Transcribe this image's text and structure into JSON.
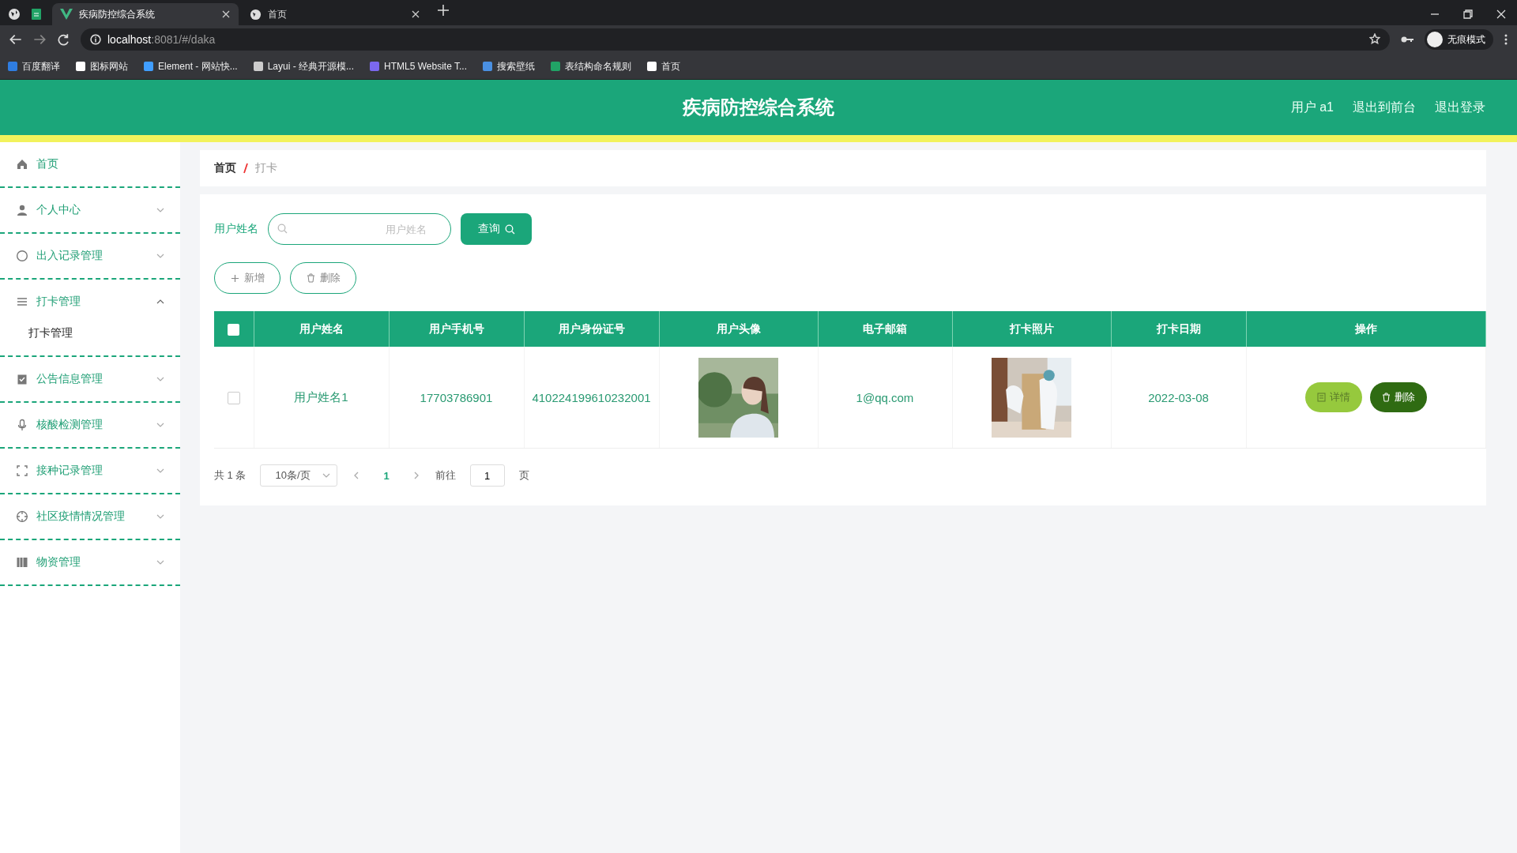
{
  "browser": {
    "tabs": [
      {
        "title": "疾病防控综合系统",
        "selected": true
      },
      {
        "title": "首页",
        "selected": false
      }
    ],
    "url_host": "localhost",
    "url_rest": ":8081/#/daka",
    "bookmarks": [
      {
        "label": "百度翻译",
        "color": "#2f7de1"
      },
      {
        "label": "图标网站",
        "color": "#ffffff"
      },
      {
        "label": "Element - 网站快...",
        "color": "#409eff"
      },
      {
        "label": "Layui - 经典开源模...",
        "color": "#cccccc"
      },
      {
        "label": "HTML5 Website T...",
        "color": "#7b68ee"
      },
      {
        "label": "搜索壁纸",
        "color": "#4a90e2"
      },
      {
        "label": "表结构命名规则",
        "color": "#21a366"
      },
      {
        "label": "首页",
        "color": "#ffffff"
      }
    ],
    "profile": "无痕模式"
  },
  "header": {
    "title": "疾病防控综合系统",
    "links": [
      "用户 a1",
      "退出到前台",
      "退出登录"
    ]
  },
  "sidebar": {
    "items": [
      {
        "kind": "home",
        "label": "首页"
      },
      {
        "kind": "user",
        "label": "个人中心",
        "expanded": false
      },
      {
        "kind": "compass",
        "label": "出入记录管理",
        "expanded": false
      },
      {
        "kind": "list",
        "label": "打卡管理",
        "expanded": true,
        "children": [
          {
            "label": "打卡管理"
          }
        ]
      },
      {
        "kind": "clipboard",
        "label": "公告信息管理",
        "expanded": false
      },
      {
        "kind": "mic",
        "label": "核酸检测管理",
        "expanded": false
      },
      {
        "kind": "frame",
        "label": "接种记录管理",
        "expanded": false
      },
      {
        "kind": "target",
        "label": "社区疫情情况管理",
        "expanded": false
      },
      {
        "kind": "books",
        "label": "物资管理",
        "expanded": false
      }
    ]
  },
  "breadcrumb": [
    "首页",
    "打卡"
  ],
  "search": {
    "label": "用户姓名",
    "placeholder": "用户姓名",
    "button": "查询"
  },
  "actions": [
    "新增",
    "删除"
  ],
  "table": {
    "header_checked": false,
    "columns": [
      "用户姓名",
      "用户手机号",
      "用户身份证号",
      "用户头像",
      "电子邮箱",
      "打卡照片",
      "打卡日期",
      "操作"
    ],
    "rows": [
      {
        "checked": false,
        "name": "用户姓名1",
        "phone": "17703786901",
        "id_number": "410224199610232001",
        "email": "1@qq.com",
        "date": "2022-03-08",
        "buttons": [
          "详情",
          "删除"
        ]
      }
    ]
  },
  "pagination": {
    "total": "共 1 条",
    "page_size": "10条/页",
    "pages": [
      {
        "label": "1",
        "selected": true
      }
    ],
    "goto": "前往",
    "goto_value": "1",
    "page_unit": "页"
  }
}
